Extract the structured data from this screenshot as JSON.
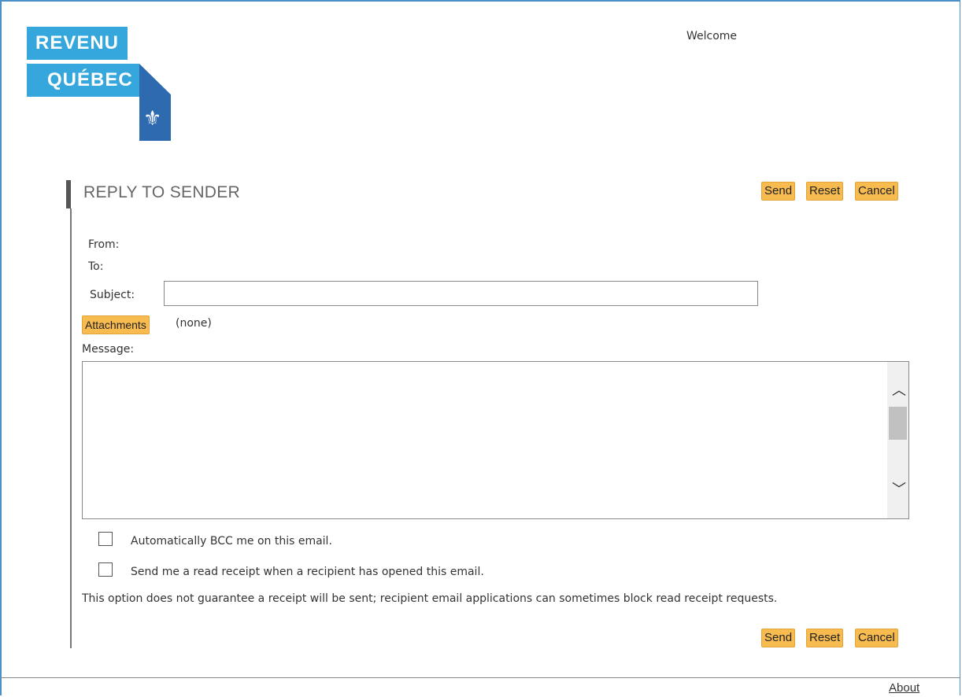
{
  "header": {
    "logo_line1": "REVENU",
    "logo_line2": "QUÉBEC",
    "logo_icon": "fleur-de-lis-icon",
    "welcome": "Welcome"
  },
  "form": {
    "title": "REPLY TO SENDER",
    "buttons": {
      "send": "Send",
      "reset": "Reset",
      "cancel": "Cancel"
    },
    "from_label": "From:",
    "to_label": "To:",
    "subject_label": "Subject:",
    "subject_value": "",
    "attachments_button": "Attachments",
    "attachments_value": "(none)",
    "message_label": "Message:",
    "message_value": ""
  },
  "options": {
    "bcc_label": "Automatically BCC me on this email.",
    "bcc_checked": false,
    "receipt_label": "Send me a read receipt when a recipient has opened this email.",
    "receipt_checked": false,
    "note": "This option does not guarantee a receipt will be sent; recipient email applications can sometimes block read receipt requests."
  },
  "footer": {
    "about": "About"
  },
  "colors": {
    "brand_light": "#35a7dd",
    "brand_dark": "#2e6ab0",
    "button": "#f7bb50",
    "frame": "#4a90c8"
  }
}
